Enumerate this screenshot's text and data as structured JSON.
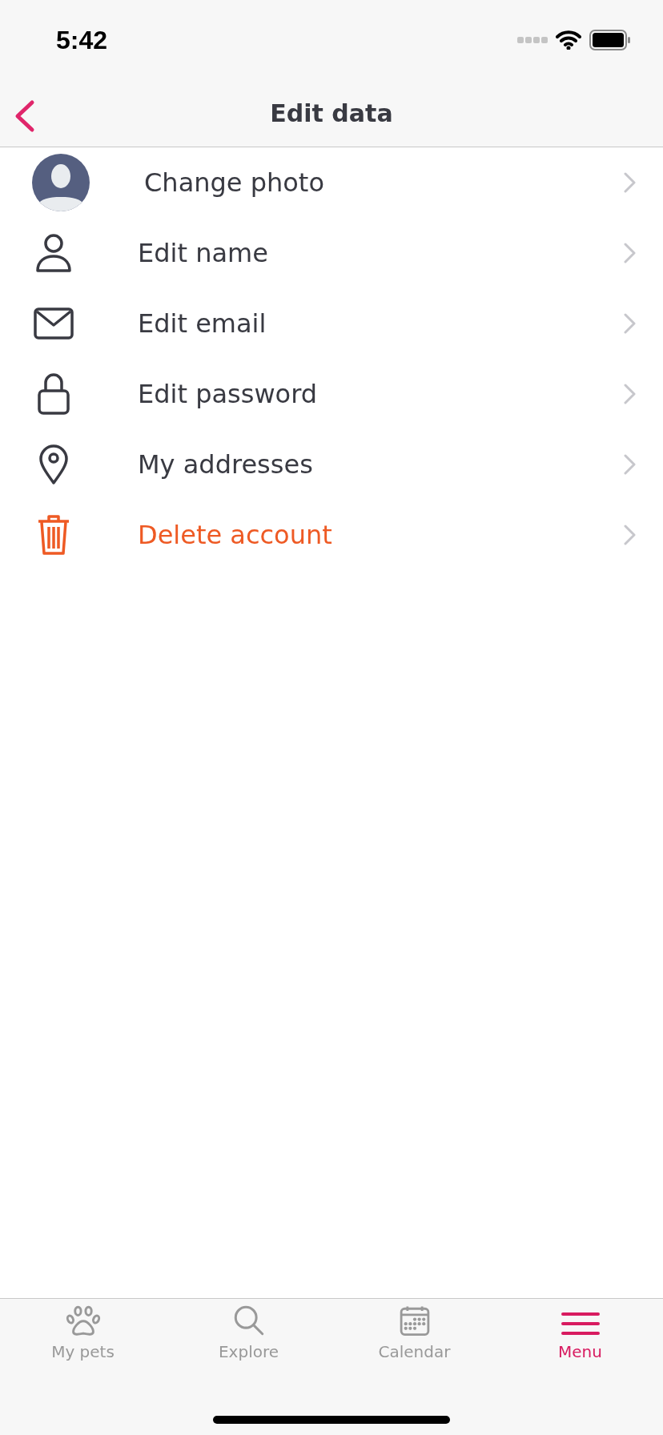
{
  "status_bar": {
    "time": "5:42"
  },
  "header": {
    "title": "Edit data"
  },
  "rows": [
    {
      "kind": "photo",
      "label": "Change photo"
    },
    {
      "kind": "plain",
      "label": "Edit name"
    },
    {
      "kind": "plain",
      "label": "Edit email"
    },
    {
      "kind": "plain",
      "label": "Edit password"
    },
    {
      "kind": "plain",
      "label": "My addresses"
    },
    {
      "kind": "danger",
      "label": "Delete account"
    }
  ],
  "tab_bar": [
    {
      "label": "My pets",
      "selected": false
    },
    {
      "label": "Explore",
      "selected": false
    },
    {
      "label": "Calendar",
      "selected": false
    },
    {
      "label": "Menu",
      "selected": true
    }
  ]
}
